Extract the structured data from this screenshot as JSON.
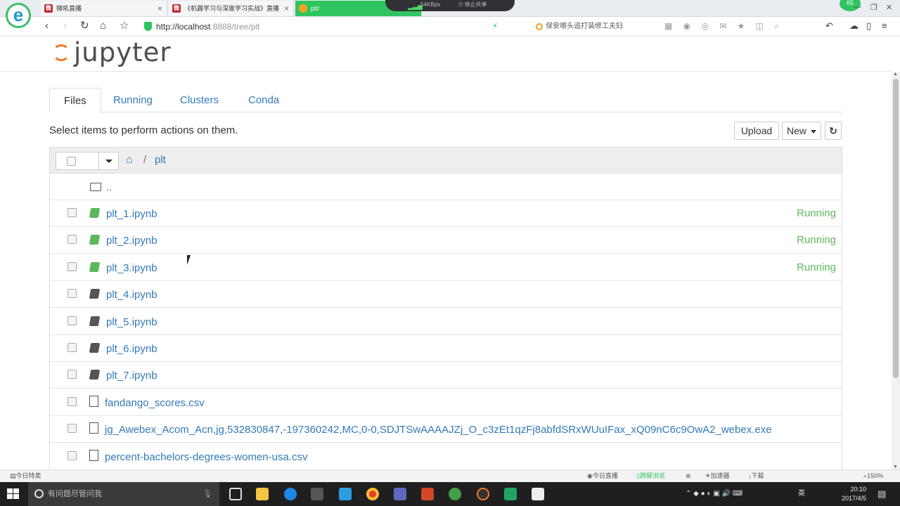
{
  "browser": {
    "tabs": [
      {
        "label": "微吼直播",
        "icon": "微"
      },
      {
        "label": "《机器学习与深度学习实战》直播",
        "icon": "微"
      },
      {
        "label": "plt/",
        "icon": ""
      }
    ],
    "share": {
      "speed": "54KBps",
      "stop_label": "停止共享"
    },
    "badge": "65",
    "url_host": "http://localhost",
    "url_rest": ":8888/tree/plt",
    "search_text": "保安哪头追打装修工夫妇",
    "toolbar_icons": "▦ ◉ ◎ ✉ ★ ◫ ⌕"
  },
  "jupyter": {
    "logo_text": "jupyter",
    "tabs": [
      "Files",
      "Running",
      "Clusters",
      "Conda"
    ],
    "hint": "Select items to perform actions on them.",
    "upload_label": "Upload",
    "new_label": "New",
    "refresh_icon": "↻",
    "breadcrumb": {
      "home_icon": "⌂",
      "sep": "/",
      "dir": "plt"
    },
    "parent": "..",
    "files": [
      {
        "name": "plt_1.ipynb",
        "type": "notebook",
        "status": "Running"
      },
      {
        "name": "plt_2.ipynb",
        "type": "notebook",
        "status": "Running"
      },
      {
        "name": "plt_3.ipynb",
        "type": "notebook",
        "status": "Running"
      },
      {
        "name": "plt_4.ipynb",
        "type": "notebook",
        "status": ""
      },
      {
        "name": "plt_5.ipynb",
        "type": "notebook",
        "status": ""
      },
      {
        "name": "plt_6.ipynb",
        "type": "notebook",
        "status": ""
      },
      {
        "name": "plt_7.ipynb",
        "type": "notebook",
        "status": ""
      },
      {
        "name": "fandango_scores.csv",
        "type": "file",
        "status": ""
      },
      {
        "name": "jg_Awebex_Acom_Acn,jg,532830847,-197360242,MC,0-0,SDJTSwAAAAJZj_O_c3zEt1qzFj8abfdSRxWUuIFax_xQ09nC6c9OwA2_webex.exe",
        "type": "file",
        "status": ""
      },
      {
        "name": "percent-bachelors-degrees-women-usa.csv",
        "type": "file",
        "status": ""
      }
    ]
  },
  "statusbar": {
    "left": "今日特卖",
    "items": [
      "今日直播",
      "跨屏浏览",
      "加速器",
      "下载"
    ],
    "zoom": "150%"
  },
  "taskbar": {
    "search_placeholder": "有问题尽管问我",
    "ime": "英",
    "time": "20:10",
    "date": "2017/4/5"
  }
}
